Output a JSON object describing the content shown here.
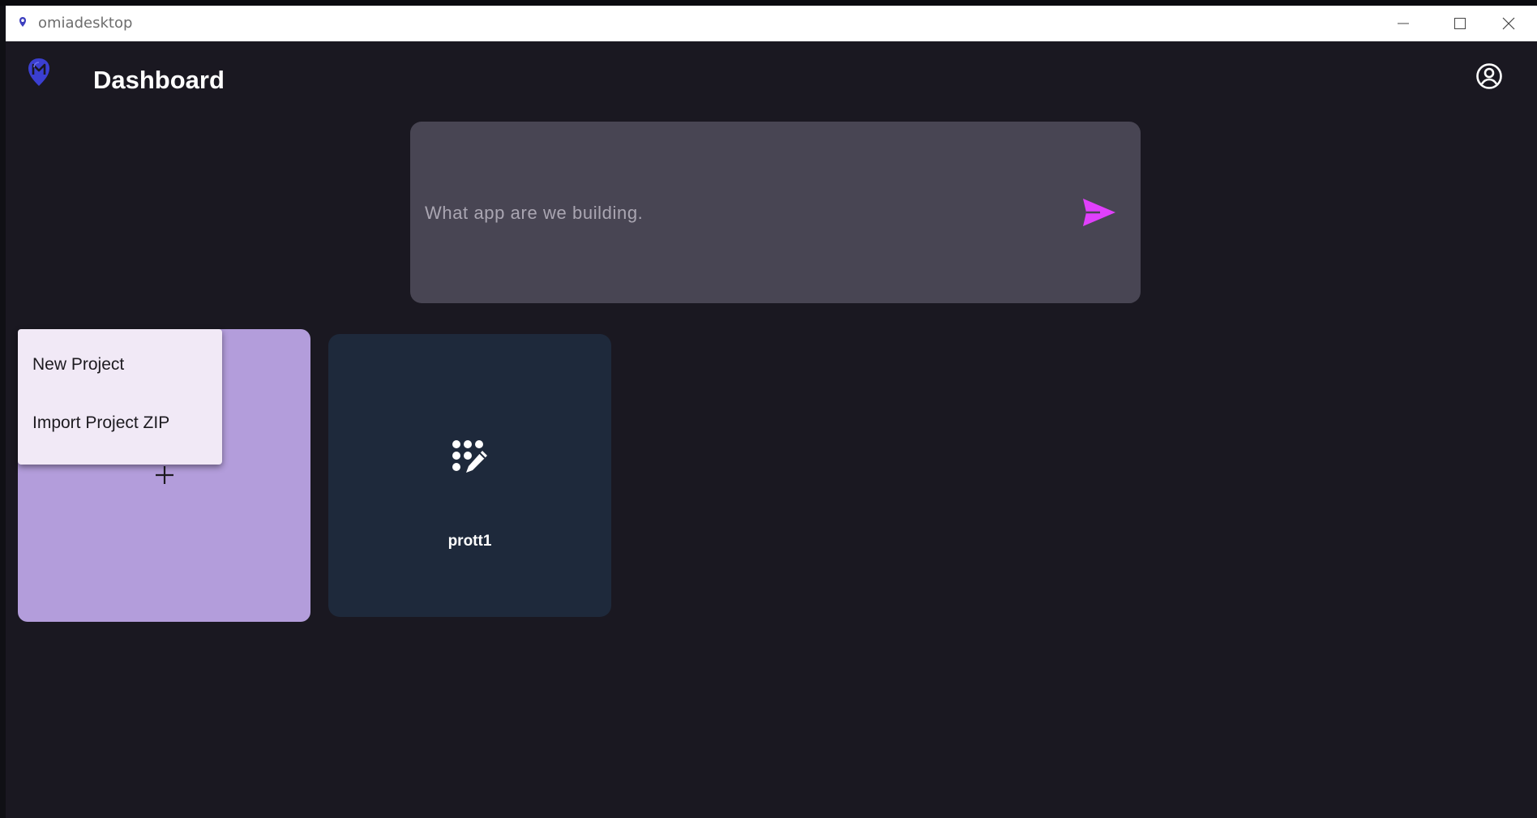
{
  "window": {
    "title": "omiadesktop"
  },
  "header": {
    "title": "Dashboard",
    "logo_icon": "omia-logo-icon",
    "account_icon": "account-circle-icon"
  },
  "prompt": {
    "placeholder": "What app are we building.",
    "value": "",
    "send_icon": "send-icon",
    "send_color": "#e040fb"
  },
  "new_project_card": {
    "icon": "plus-icon",
    "color": "#b39ddb"
  },
  "context_menu": {
    "items": [
      {
        "label": "New Project"
      },
      {
        "label": "Import Project ZIP"
      }
    ]
  },
  "projects": [
    {
      "name": "prott1",
      "icon": "dots-pencil-icon",
      "color": "#1e293b"
    }
  ]
}
